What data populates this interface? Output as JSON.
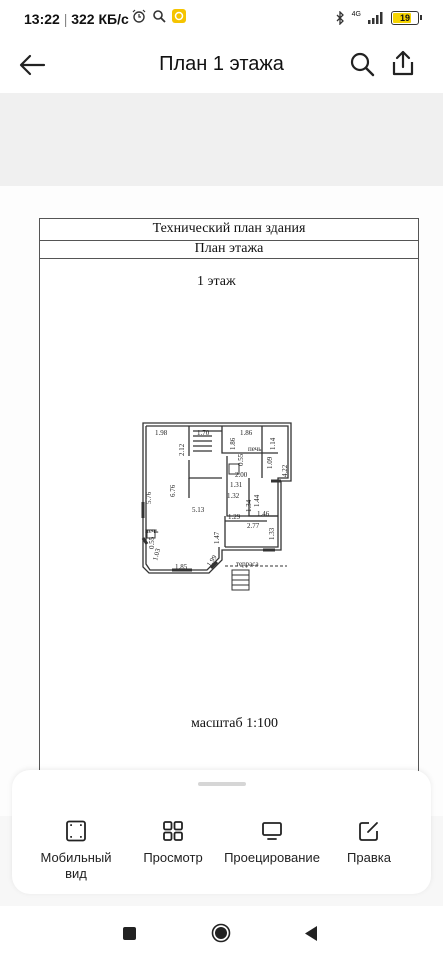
{
  "status_bar": {
    "time": "13:22",
    "speed": "322 КБ/с",
    "network": "4G",
    "battery": "19"
  },
  "app_bar": {
    "title": "План 1 этажа"
  },
  "document": {
    "header_row1": "Технический план здания",
    "header_row2": "План этажа",
    "floor_label": "1 этаж",
    "scale_label": "масштаб 1:100",
    "dimensions": [
      "1.98",
      "1.70",
      "1.86",
      "2.12",
      "1.86",
      "1.14",
      "печь",
      "0.55",
      "1.09",
      "4.22",
      "6.76",
      "5.13",
      "2.00",
      "1.31",
      "1.32",
      "1.44",
      "1.34",
      "1.46",
      "5.76",
      "1.29",
      "2.77",
      "1.33",
      "1.47",
      "печь",
      "0.55",
      "1.03",
      "1.99",
      "1.85",
      "терраса"
    ]
  },
  "bottom_sheet": {
    "items": [
      {
        "label": "Мобильный вид",
        "icon": "mobile-view-icon"
      },
      {
        "label": "Просмотр",
        "icon": "grid-view-icon"
      },
      {
        "label": "Проецирование",
        "icon": "monitor-icon"
      },
      {
        "label": "Правка",
        "icon": "edit-icon"
      }
    ]
  },
  "colors": {
    "battery_fill": "#f5d400",
    "accent_status": "#f5c400"
  }
}
